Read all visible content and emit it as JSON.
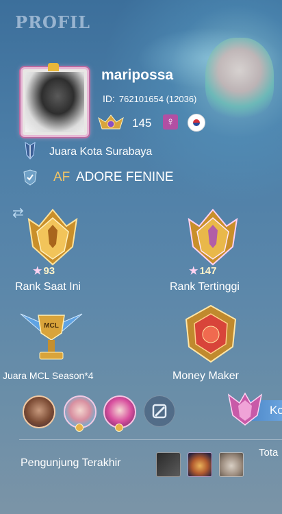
{
  "header": {
    "title": "PROFIL"
  },
  "profile": {
    "username": "maripossa",
    "id_label": "ID:",
    "id_value": "762101654 (12036)",
    "level": "145",
    "gender_symbol": "♀",
    "title_text": "Juara Kota Surabaya",
    "squad_tag": "AF",
    "squad_name": "ADORE FENINE"
  },
  "achievements": {
    "current_rank": {
      "stars": "93",
      "label": "Rank Saat Ini"
    },
    "highest_rank": {
      "stars": "147",
      "label": "Rank Tertinggi"
    },
    "mcl": {
      "emblem_text": "MCL",
      "label": "Juara MCL Season*4"
    },
    "money_maker": {
      "label": "Money Maker"
    }
  },
  "heroes": {
    "count_shown": 3
  },
  "side_button": {
    "label": "Ko"
  },
  "visitors": {
    "label": "Pengunjung Terakhir",
    "total_label": "Tota"
  },
  "colors": {
    "background": "#4d7fa8",
    "gold": "#e9b84a",
    "accent_pink": "#b24fa3"
  }
}
